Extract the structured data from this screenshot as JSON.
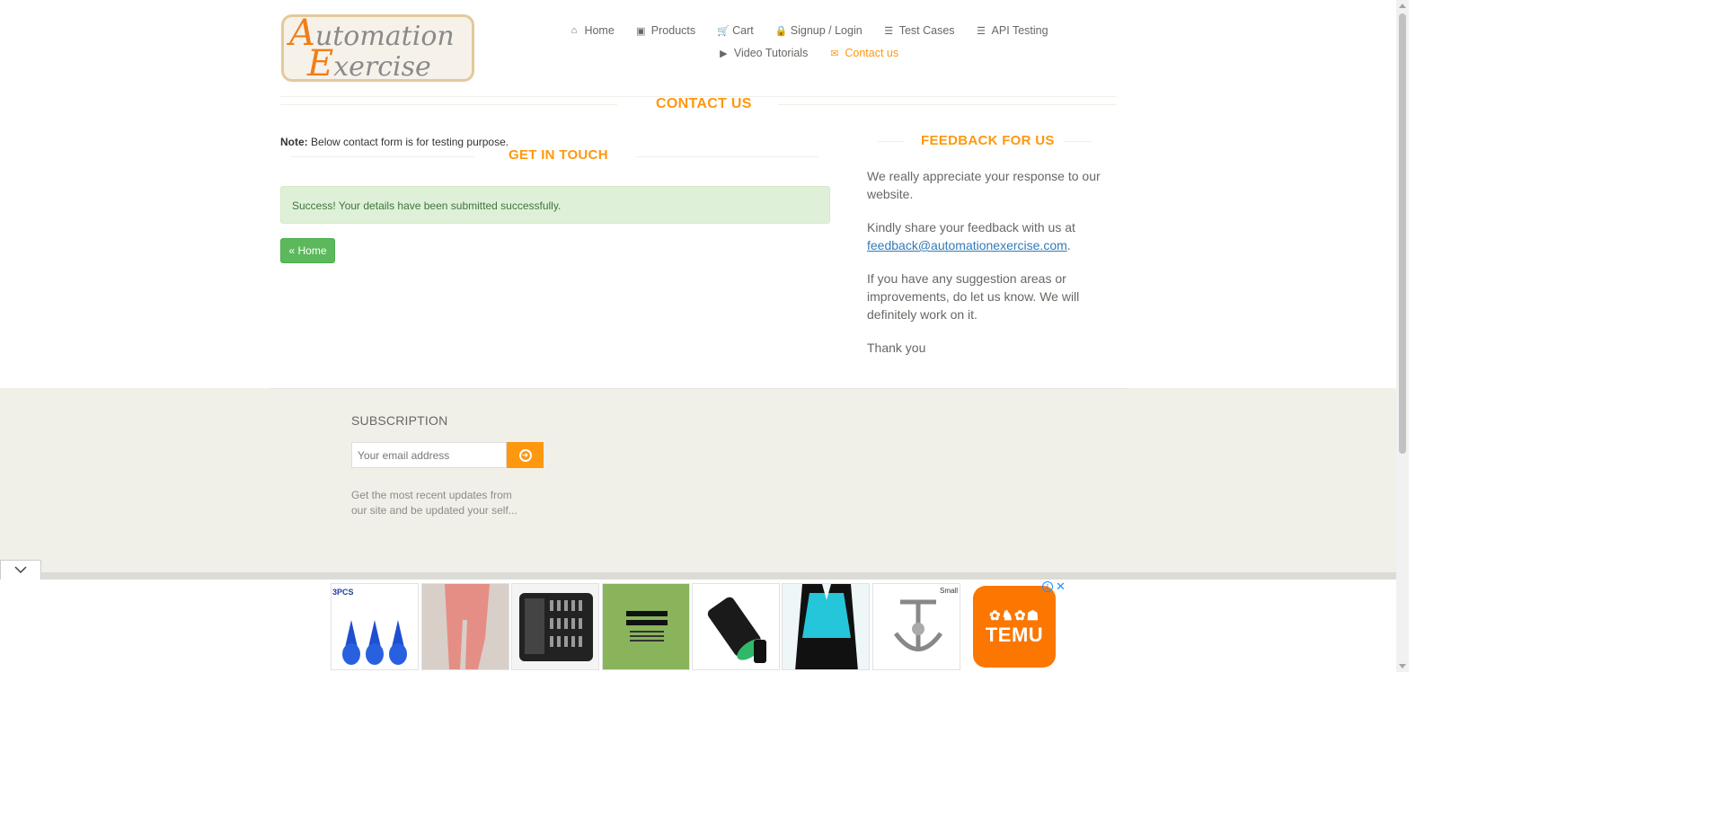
{
  "logo": {
    "line1_cap": "A",
    "line1_rest": "utomation",
    "line2_cap": "E",
    "line2_rest": "xercise"
  },
  "nav": {
    "row1": [
      {
        "label": "Home",
        "icon": "home-icon",
        "glyph": "⌂"
      },
      {
        "label": "Products",
        "icon": "products-icon",
        "glyph": "▣"
      },
      {
        "label": "Cart",
        "icon": "cart-icon",
        "glyph": "🛒"
      },
      {
        "label": "Signup / Login",
        "icon": "lock-icon",
        "glyph": "🔒"
      },
      {
        "label": "Test Cases",
        "icon": "list-icon",
        "glyph": "☰"
      },
      {
        "label": "API Testing",
        "icon": "list-icon",
        "glyph": "☰"
      }
    ],
    "row2": [
      {
        "label": "Video Tutorials",
        "icon": "youtube-icon",
        "glyph": "▶"
      },
      {
        "label": "Contact us",
        "icon": "envelope-icon",
        "glyph": "✉"
      }
    ],
    "active": "Contact us"
  },
  "contact": {
    "title": "CONTACT US",
    "note_bold": "Note:",
    "note_text": "Below contact form is for testing purpose.",
    "get_in_touch": "GET IN TOUCH",
    "success_message": "Success! Your details have been submitted successfully.",
    "home_button": "« Home"
  },
  "feedback": {
    "title": "FEEDBACK FOR US",
    "p1": "We really appreciate your response to our website.",
    "p2_text": "Kindly share your feedback with us at",
    "p2_email": "feedback@automationexercise.com",
    "p2_end": ".",
    "p3": "If you have any suggestion areas or improvements, do let us know. We will definitely work on it.",
    "p4": "Thank you"
  },
  "footer": {
    "subscription_title": "SUBSCRIPTION",
    "email_placeholder": "Your email address",
    "description": "Get the most recent updates from our site and be updated your self..."
  },
  "ad": {
    "first_label": "3PCS",
    "small_label": "Small",
    "brand": "TEMU",
    "info": "i",
    "close": "✕"
  },
  "colors": {
    "accent": "#fe980f",
    "success_bg": "#dff0d8",
    "success_text": "#3c763d",
    "home_button": "#5cb85c",
    "footer_bg": "#f0f0e9",
    "temu": "#fb7701"
  }
}
